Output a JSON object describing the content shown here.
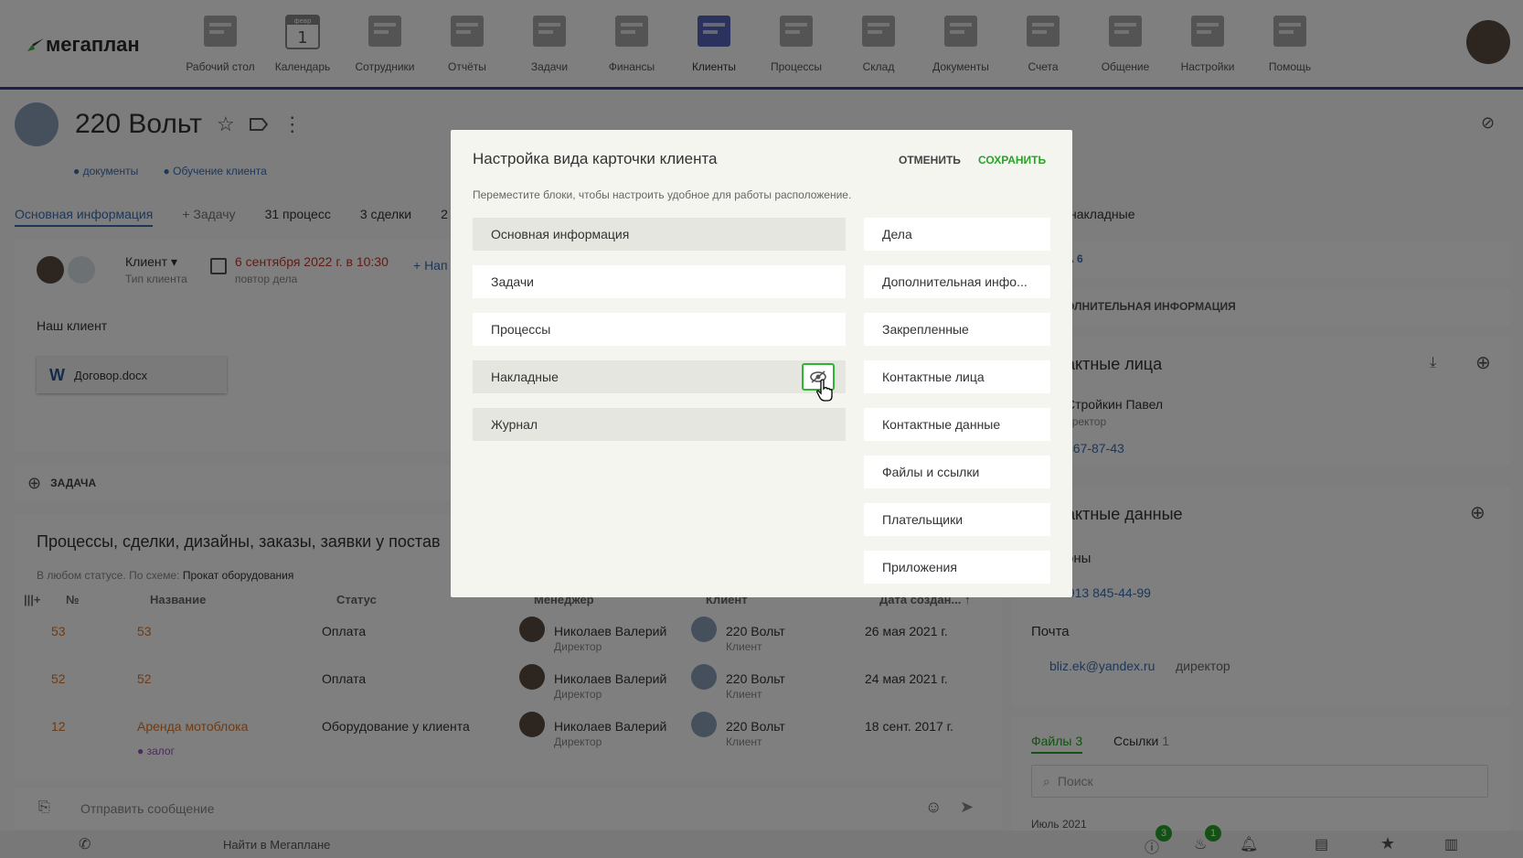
{
  "logo": {
    "text": "мегаплан"
  },
  "nav": [
    {
      "label": "Рабочий стол",
      "icon": "desktop-icon"
    },
    {
      "label": "Календарь",
      "icon": "calendar-icon",
      "badge": "1"
    },
    {
      "label": "Сотрудники",
      "icon": "employees-icon"
    },
    {
      "label": "Отчёты",
      "icon": "reports-icon"
    },
    {
      "label": "Задачи",
      "icon": "tasks-icon"
    },
    {
      "label": "Финансы",
      "icon": "finance-icon"
    },
    {
      "label": "Клиенты",
      "icon": "clients-icon",
      "active": true
    },
    {
      "label": "Процессы",
      "icon": "processes-icon"
    },
    {
      "label": "Склад",
      "icon": "warehouse-icon"
    },
    {
      "label": "Документы",
      "icon": "documents-icon"
    },
    {
      "label": "Счета",
      "icon": "invoices-icon"
    },
    {
      "label": "Общение",
      "icon": "chat-icon"
    },
    {
      "label": "Настройки",
      "icon": "settings-icon"
    },
    {
      "label": "Помощь",
      "icon": "help-icon"
    }
  ],
  "calendar_label": "февр",
  "client": {
    "name": "220 Вольт",
    "tags": [
      "документы",
      "Обучение клиента"
    ]
  },
  "tabs": [
    "Основная информация",
    "+ Задачу",
    "31 процесс",
    "3 сделки",
    "2"
  ],
  "right_tab": "накладные",
  "info": {
    "type": "Клиент",
    "type_label": "Тип клиента",
    "date": "6 сентября 2022 г. в 10:30",
    "repeat": "повтор дела",
    "add": "+ Нап",
    "note": "Наш клиент",
    "file": "Договор.docx"
  },
  "task": {
    "label": "ЗАДАЧА"
  },
  "processes": {
    "title": "Процессы, сделки, дизайны, заказы, заявки у постав",
    "filter_prefix": "В любом статусе. По схеме:",
    "filter_value": "Прокат оборудования",
    "columns": [
      "№",
      "Название",
      "Статус",
      "Менеджер",
      "Клиент",
      "Дата создан..."
    ],
    "rows": [
      {
        "num": "53",
        "name": "53",
        "status": "Оплата",
        "manager": "Николаев Валерий",
        "role": "Директор",
        "client": "220 Вольт",
        "client_role": "Клиент",
        "date": "26 мая 2021 г."
      },
      {
        "num": "52",
        "name": "52",
        "status": "Оплата",
        "manager": "Николаев Валерий",
        "role": "Директор",
        "client": "220 Вольт",
        "client_role": "Клиент",
        "date": "24 мая 2021 г."
      },
      {
        "num": "12",
        "name": "Аренда мотоблока",
        "status": "Оборудование у клиента",
        "manager": "Николаев Валерий",
        "role": "Директор",
        "client": "220 Вольт",
        "client_role": "Клиент",
        "date": "18 сент. 2017 г.",
        "tag": "залог"
      }
    ]
  },
  "message": {
    "placeholder": "Отправить сообщение"
  },
  "right": {
    "deals_label": "А",
    "deals_count": "6",
    "extra": "ОЛНИТЕЛЬНАЯ ИНФОРМАЦИЯ",
    "contacts": "актные лица",
    "person": "Стройкин Павел",
    "person_role": "иректор",
    "phone1": "467-87-43",
    "contact_data": "актные данные",
    "phones": "оны",
    "phone2": "+7 913 845-44-99",
    "email_label": "Почта",
    "email": "bliz.ek@yandex.ru",
    "email_role": "директор",
    "files": "Файлы",
    "files_count": "3",
    "links": "Ссылки",
    "links_count": "1",
    "search": "Поиск",
    "month": "Июль 2021"
  },
  "bottom": {
    "search": "Найти в Мегаплане",
    "badge1": "3",
    "badge2": "1"
  },
  "modal": {
    "title": "Настройка вида карточки клиента",
    "cancel": "ОТМЕНИТЬ",
    "save": "СОХРАНИТЬ",
    "hint": "Переместите блоки, чтобы настроить удобное для работы расположение.",
    "left": [
      {
        "label": "Основная информация",
        "hidden": true
      },
      {
        "label": "Задачи",
        "hidden": false
      },
      {
        "label": "Процессы",
        "hidden": false
      },
      {
        "label": "Накладные",
        "hidden": true
      },
      {
        "label": "Журнал",
        "hidden": true
      }
    ],
    "right": [
      "Дела",
      "Дополнительная инфо...",
      "Закрепленные",
      "Контактные лица",
      "Контактные данные",
      "Файлы и ссылки",
      "Плательщики",
      "Приложения"
    ]
  },
  "colors": {
    "accent": "#3c6fb0",
    "save": "#29a329",
    "nav_border": "#3a3a9e",
    "danger": "#c0392b"
  }
}
